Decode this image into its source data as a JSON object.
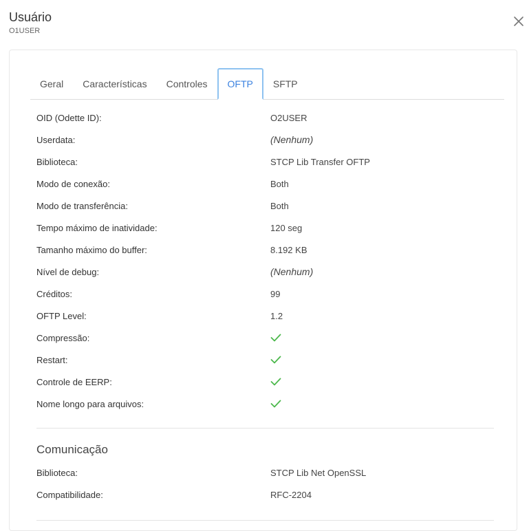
{
  "header": {
    "title": "Usuário",
    "subtitle": "O1USER"
  },
  "tabs": [
    {
      "label": "Geral"
    },
    {
      "label": "Características"
    },
    {
      "label": "Controles"
    },
    {
      "label": "OFTP",
      "active": true
    },
    {
      "label": "SFTP"
    }
  ],
  "oftp": {
    "rows": [
      {
        "label": "OID (Odette ID):",
        "value": "O2USER"
      },
      {
        "label": "Userdata:",
        "value": "(Nenhum)"
      },
      {
        "label": "Biblioteca:",
        "value": "STCP Lib Transfer OFTP"
      },
      {
        "label": "Modo de conexão:",
        "value": "Both"
      },
      {
        "label": "Modo de transferência:",
        "value": "Both"
      },
      {
        "label": "Tempo máximo de inatividade:",
        "value": "120 seg"
      },
      {
        "label": "Tamanho máximo do buffer:",
        "value": "8.192 KB"
      },
      {
        "label": "Nível de debug:",
        "value": "(Nenhum)"
      },
      {
        "label": "Créditos:",
        "value": "99"
      },
      {
        "label": "OFTP Level:",
        "value": "1.2"
      },
      {
        "label": "Compressão:",
        "value": "check-icon"
      },
      {
        "label": "Restart:",
        "value": "check-icon"
      },
      {
        "label": "Controle de EERP:",
        "value": "check-icon"
      },
      {
        "label": "Nome longo para arquivos:",
        "value": "check-icon"
      }
    ]
  },
  "comunicacao": {
    "title": "Comunicação",
    "rows": [
      {
        "label": "Biblioteca:",
        "value": "STCP Lib Net OpenSSL"
      },
      {
        "label": "Compatibilidade:",
        "value": "RFC-2204"
      }
    ]
  },
  "colors": {
    "accent": "#3b82e0",
    "tab_border": "#8ec2f0",
    "check": "#4cb84c"
  }
}
